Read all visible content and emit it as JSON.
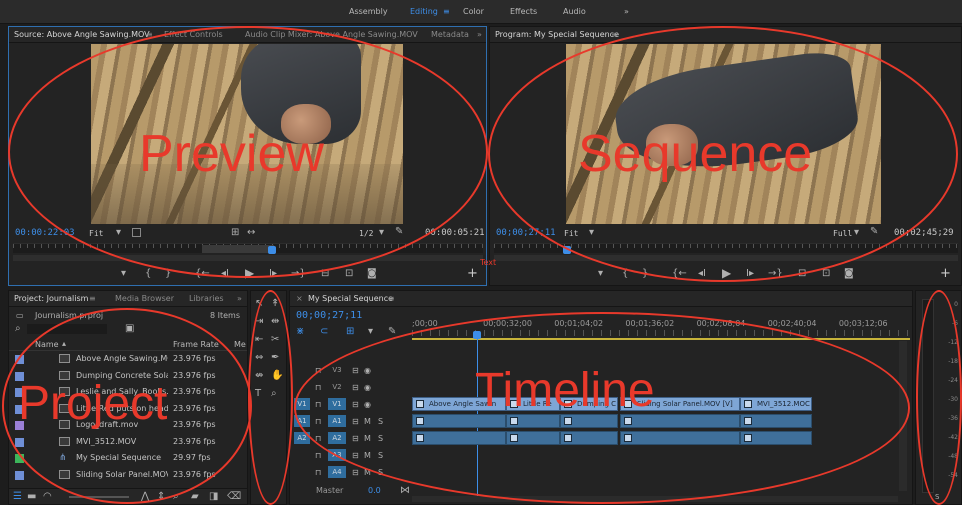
{
  "workspaces": {
    "items": [
      "Assembly",
      "Editing",
      "Color",
      "Effects",
      "Audio"
    ],
    "active_menu_icon": "≡",
    "overflow": "»"
  },
  "source": {
    "tabs": [
      "Source: Above Angle Sawing.MOV",
      "Effect Controls",
      "Audio Clip Mixer: Above Angle Sawing.MOV",
      "Metadata"
    ],
    "menu_icon": "≡",
    "overflow": "»",
    "timecode": "00:00:22:03",
    "fit": "Fit",
    "resolution": "1/2",
    "duration": "00:00:05:21",
    "annotation": "Preview"
  },
  "program": {
    "tab": "Program: My Special Sequence",
    "menu_icon": "≡",
    "timecode": "00;00;27;11",
    "fit": "Fit",
    "resolution": "Full",
    "duration": "00;02;45;29",
    "annotation": "Sequence",
    "stray_label": "Text"
  },
  "project": {
    "tabs": [
      "Project: Journalism",
      "Media Browser",
      "Libraries"
    ],
    "menu_icon": "≡",
    "overflow": "»",
    "file": "Journalism.prproj",
    "count": "8 Items",
    "col_name": "Name",
    "col_rate": "Frame Rate",
    "col_media": "Me",
    "items": [
      {
        "name": "Above Angle Sawing.MOV",
        "fps": "23.976 fps",
        "color": "#6f8fd6",
        "kind": "clip"
      },
      {
        "name": "Dumping Concrete Solar P",
        "fps": "23.976 fps",
        "color": "#6f8fd6",
        "kind": "clip"
      },
      {
        "name": "Leslie and Sally_Books.Mo",
        "fps": "23.976 fps",
        "color": "#6f8fd6",
        "kind": "clip"
      },
      {
        "name": "Little Red puts on head",
        "fps": "23.976 fps",
        "color": "#6f8fd6",
        "kind": "clip"
      },
      {
        "name": "Logo_draft.mov",
        "fps": "23.976 fps",
        "color": "#9a7fd6",
        "kind": "still"
      },
      {
        "name": "MVI_3512.MOV",
        "fps": "23.976 fps",
        "color": "#6f8fd6",
        "kind": "clip"
      },
      {
        "name": "My Special Sequence",
        "fps": "29.97 fps",
        "color": "#3cb55a",
        "kind": "sequence"
      },
      {
        "name": "Sliding Solar Panel.MOV",
        "fps": "23.976 fps",
        "color": "#6f8fd6",
        "kind": "clip"
      }
    ],
    "annotation": "Project"
  },
  "timeline": {
    "tab": "My Special Sequence",
    "menu_icon": "≡",
    "close": "×",
    "timecode": "00;00;27;11",
    "ruler": [
      ";00;00",
      "00;00;32;00",
      "00;01;04;02",
      "00;01;36;02",
      "00;02;08;04",
      "00;02;40;04",
      "00;03;12;06"
    ],
    "video_tracks": [
      "V3",
      "V2",
      "V1"
    ],
    "audio_tracks": [
      "A1",
      "A2",
      "A3",
      "A4"
    ],
    "master": "Master",
    "master_value": "0.0",
    "clips": [
      "Above Angle Sawin",
      "Little Re",
      "Dumping C",
      "Sliding Solar Panel.MOV [V]",
      "MVI_3512.MOC"
    ],
    "annotation": "Timeline"
  },
  "meter": {
    "ticks": [
      "0",
      "-6",
      "-12",
      "-18",
      "-24",
      "-30",
      "-36",
      "-42",
      "-48",
      "-54"
    ],
    "solo": "S"
  }
}
